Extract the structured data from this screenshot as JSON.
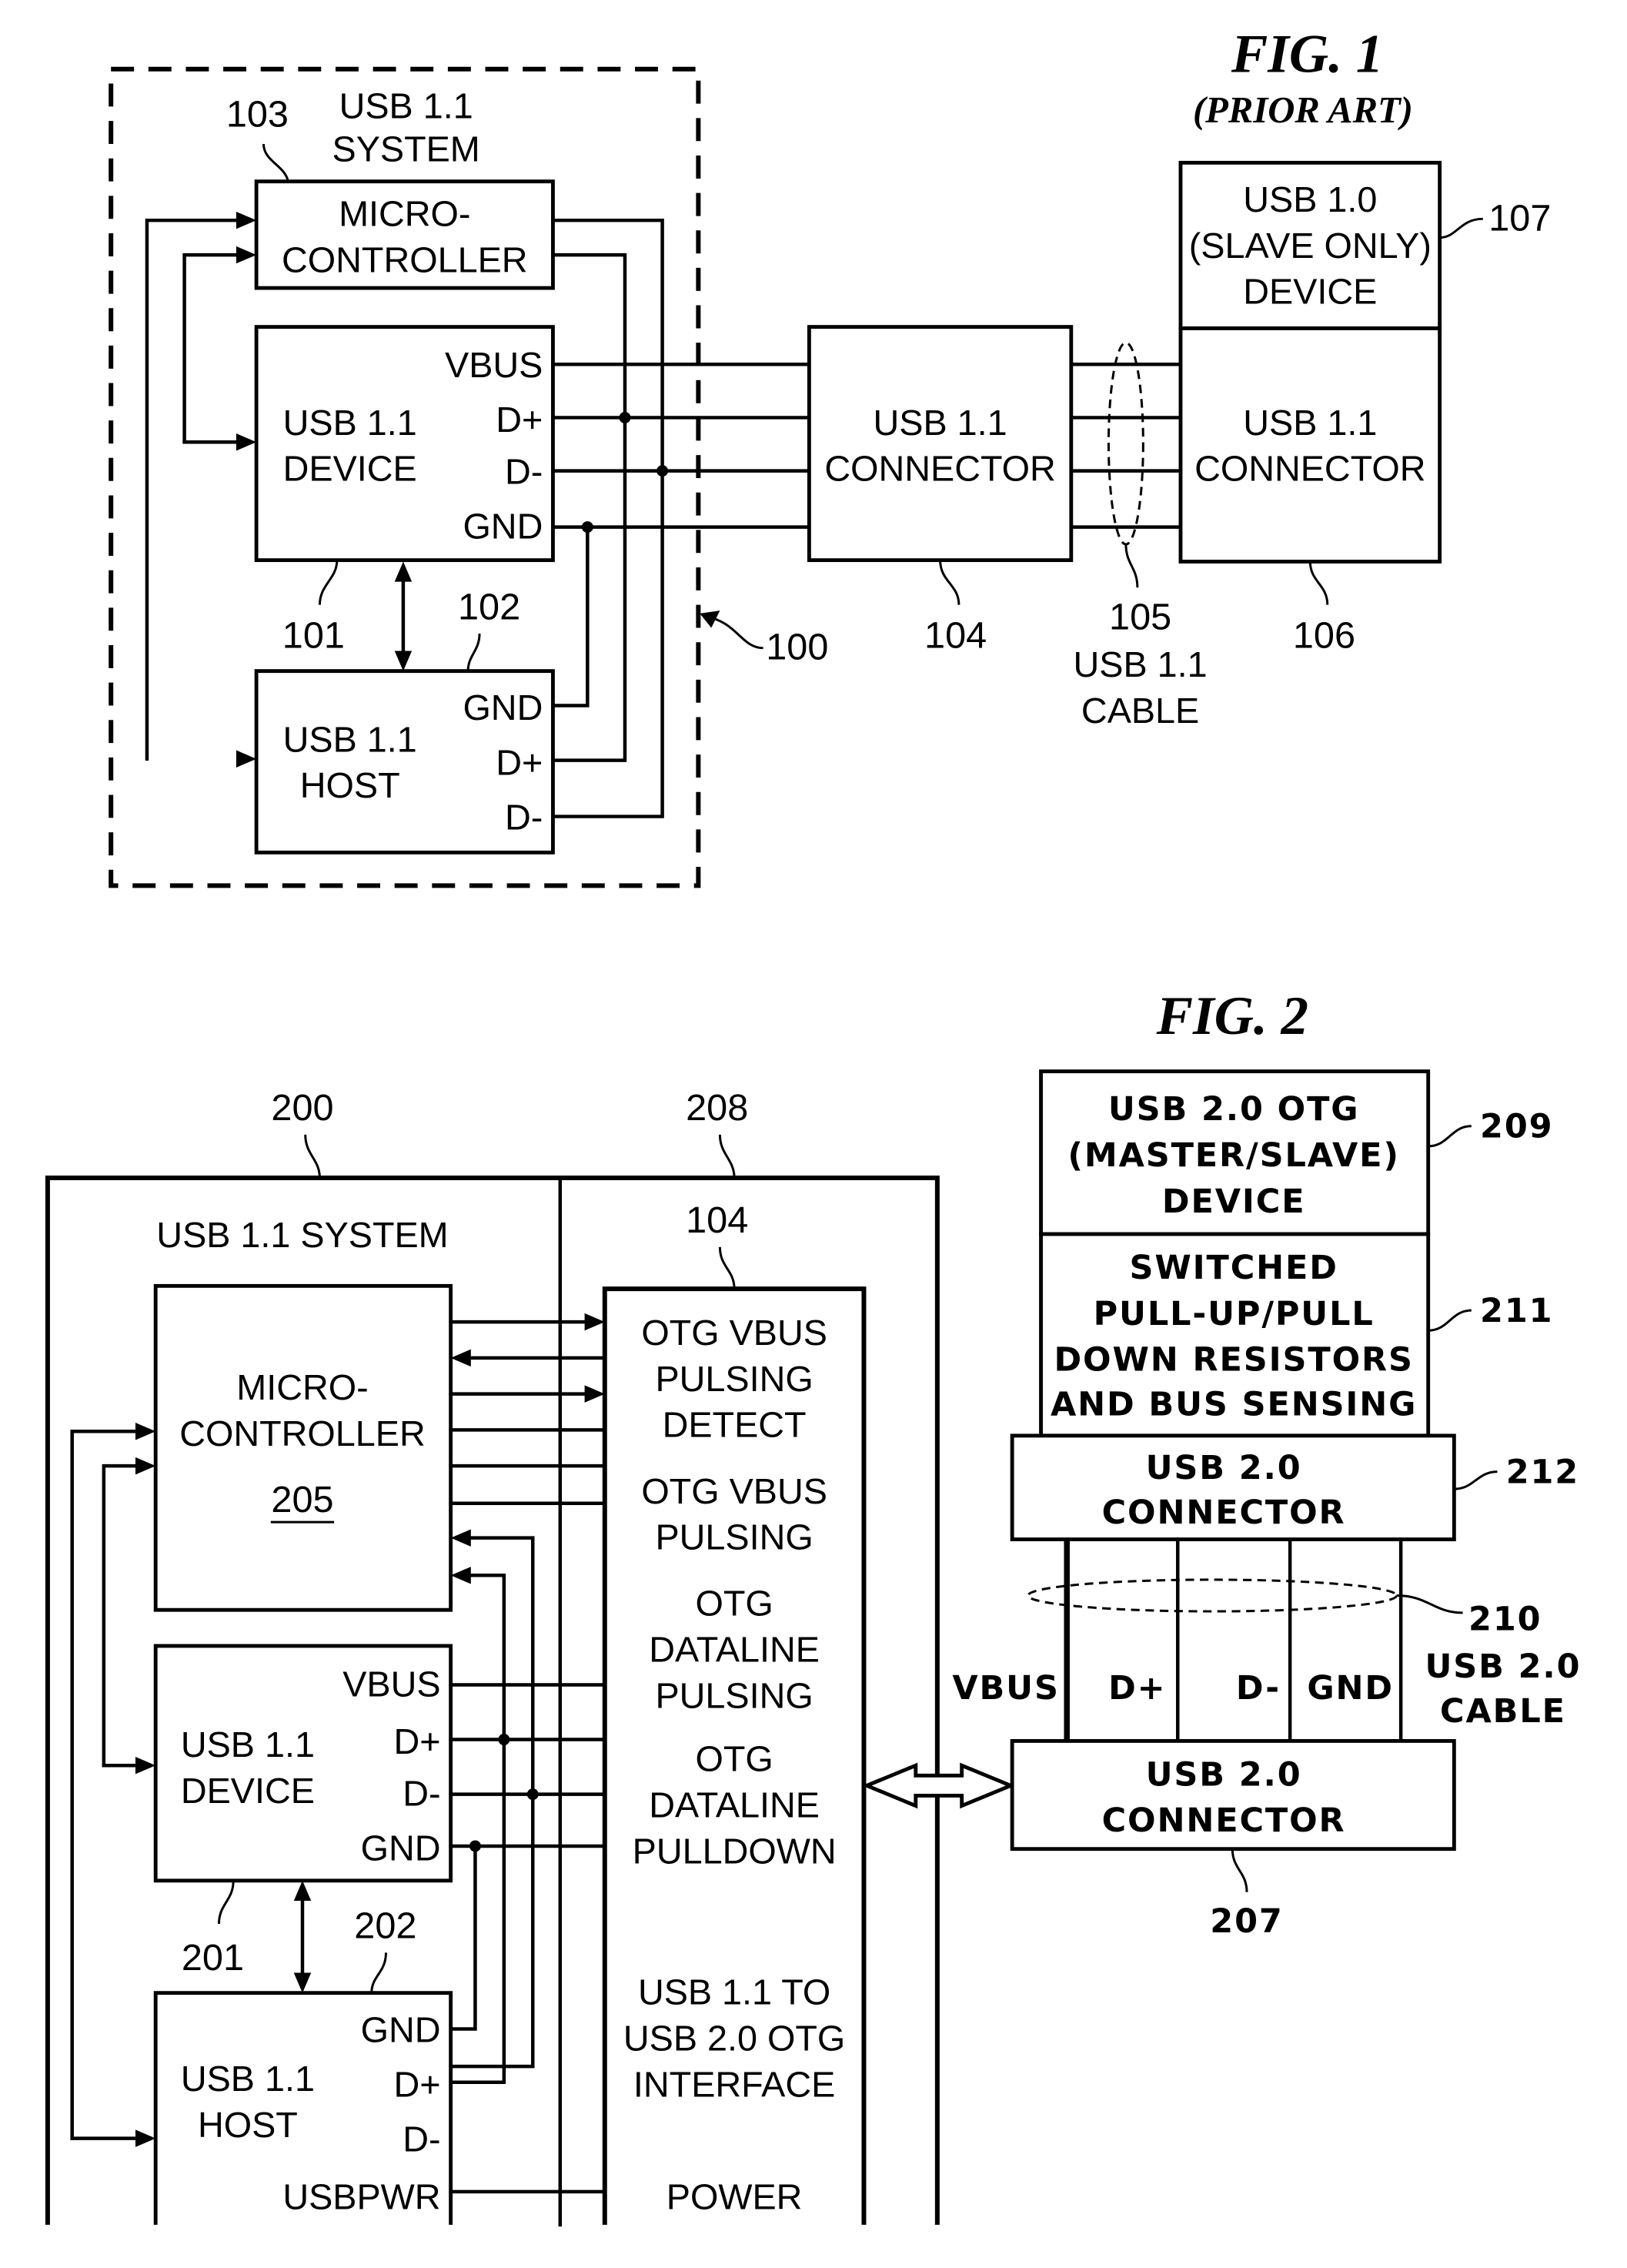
{
  "fig1": {
    "title": "FIG. 1",
    "subtitle": "(PRIOR ART)",
    "system": {
      "ref": "100",
      "label_line1": "USB 1.1",
      "label_line2": "SYSTEM"
    },
    "microcontroller": {
      "ref": "103",
      "line1": "MICRO-",
      "line2": "CONTROLLER"
    },
    "device": {
      "ref": "101",
      "line1": "USB 1.1",
      "line2": "DEVICE",
      "pins": [
        "VBUS",
        "D+",
        "D-",
        "GND"
      ]
    },
    "host": {
      "ref": "102",
      "line1": "USB 1.1",
      "line2": "HOST",
      "pins": [
        "GND",
        "D+",
        "D-"
      ]
    },
    "connector": {
      "ref": "104",
      "line1": "USB 1.1",
      "line2": "CONNECTOR"
    },
    "cable": {
      "ref": "105",
      "line1": "USB 1.1",
      "line2": "CABLE"
    },
    "remote_connector": {
      "ref": "106",
      "line1": "USB 1.1",
      "line2": "CONNECTOR"
    },
    "remote_device": {
      "ref": "107",
      "line1": "USB 1.0",
      "line2": "(SLAVE ONLY)",
      "line3": "DEVICE"
    }
  },
  "fig2": {
    "title": "FIG. 2",
    "system": {
      "ref": "200",
      "label": "USB 1.1 SYSTEM"
    },
    "interface_block": {
      "ref": "208"
    },
    "interface": {
      "ref": "104",
      "sections": [
        [
          "OTG VBUS",
          "PULSING",
          "DETECT"
        ],
        [
          "OTG VBUS",
          "PULSING"
        ],
        [
          "OTG",
          "DATALINE",
          "PULSING"
        ],
        [
          "OTG",
          "DATALINE",
          "PULLDOWN"
        ],
        [
          "USB 1.1 TO",
          "USB 2.0 OTG",
          "INTERFACE"
        ],
        [
          "POWER"
        ]
      ]
    },
    "microcontroller": {
      "ref": "205",
      "line1": "MICRO-",
      "line2": "CONTROLLER"
    },
    "device": {
      "ref": "201",
      "line1": "USB 1.1",
      "line2": "DEVICE",
      "pins": [
        "VBUS",
        "D+",
        "D-",
        "GND"
      ]
    },
    "host": {
      "ref": "202",
      "line1": "USB 1.1",
      "line2": "HOST",
      "pins": [
        "GND",
        "D+",
        "D-",
        "USBPWR"
      ]
    },
    "otg_device": {
      "ref": "209",
      "line1": "USB 2.0 OTG",
      "line2": "(MASTER/SLAVE)",
      "line3": "DEVICE"
    },
    "resistors": {
      "ref": "211",
      "line1": "SWITCHED",
      "line2": "PULL-UP/PULL",
      "line3": "DOWN RESISTORS",
      "line4": "AND BUS SENSING"
    },
    "upper_connector": {
      "ref": "212",
      "line1": "USB 2.0",
      "line2": "CONNECTOR"
    },
    "cable": {
      "ref": "210",
      "line1": "USB 2.0",
      "line2": "CABLE",
      "wires": [
        "VBUS",
        "D+",
        "D-",
        "GND"
      ]
    },
    "lower_connector": {
      "ref": "207",
      "line1": "USB 2.0",
      "line2": "CONNECTOR"
    }
  }
}
